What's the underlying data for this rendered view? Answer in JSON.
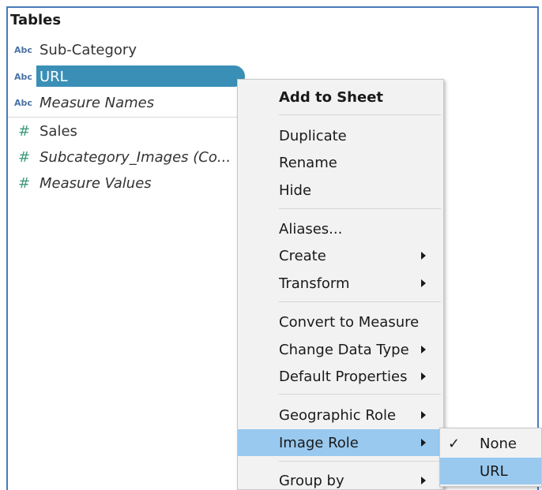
{
  "pane": {
    "title": "Tables",
    "fields": [
      {
        "type": "Abc",
        "name": "Sub-Category"
      },
      {
        "type": "Abc",
        "name": "URL"
      },
      {
        "type": "Abc",
        "name": "Measure Names"
      },
      {
        "type": "#",
        "name": "Sales"
      },
      {
        "type": "#",
        "name": "Subcategory_Images (Co..."
      },
      {
        "type": "#",
        "name": "Measure Values"
      }
    ]
  },
  "menu": {
    "items": [
      {
        "label": "Add to Sheet"
      },
      {
        "label": "Duplicate"
      },
      {
        "label": "Rename"
      },
      {
        "label": "Hide"
      },
      {
        "label": "Aliases..."
      },
      {
        "label": "Create"
      },
      {
        "label": "Transform"
      },
      {
        "label": "Convert to Measure"
      },
      {
        "label": "Change Data Type"
      },
      {
        "label": "Default Properties"
      },
      {
        "label": "Geographic Role"
      },
      {
        "label": "Image Role"
      },
      {
        "label": "Group by"
      }
    ]
  },
  "submenu": {
    "items": [
      {
        "label": "None",
        "checked": true
      },
      {
        "label": "URL"
      }
    ],
    "check_glyph": "✓"
  },
  "colors": {
    "selection_pill": "#3a8fb7",
    "menu_highlight": "#99c9ef",
    "pane_border": "#4a7ab8",
    "dimension_icon": "#4a72a5",
    "measure_icon": "#3f9c7a"
  }
}
